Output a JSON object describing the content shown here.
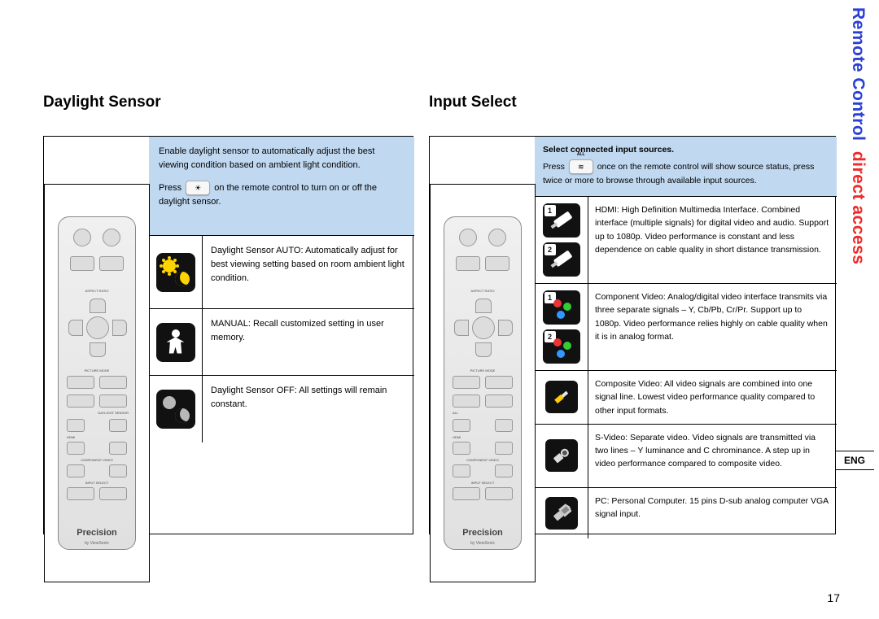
{
  "side_tab": {
    "line1": "Remote Control",
    "line2": "direct access"
  },
  "lang_badge": "ENG",
  "page_number": "17",
  "remote": {
    "brand": "Precision",
    "sub": "by ViewSonic",
    "labels": [
      "ASPECT RATIO",
      "PICTURE MODE",
      "DAYLIGHT SENSOR",
      "HDMI",
      "COMPONENT VIDEO",
      "INPUT SELECT",
      "ALL"
    ]
  },
  "daylight": {
    "title": "Daylight Sensor",
    "banner_line1": "Enable daylight sensor to automatically adjust the best viewing condition based on ambient light condition.",
    "banner_press": "Press",
    "banner_key": "☀",
    "banner_line2": "on the remote control to turn on or off the daylight sensor.",
    "rows": [
      {
        "icon": "sun-moon",
        "text": "Daylight Sensor AUTO: Automatically adjust for best viewing setting based on room ambient light condition."
      },
      {
        "icon": "person",
        "text": "MANUAL: Recall customized setting in user memory."
      },
      {
        "icon": "off",
        "text": "Daylight Sensor OFF: All settings will remain constant."
      }
    ]
  },
  "input": {
    "title": "Input Select",
    "banner_bold": "Select connected input sources.",
    "banner_press": "Press",
    "banner_key": "≋",
    "banner_key_label": "ALL",
    "banner_after": "once on the remote control will show source status, press twice or more to browse through available input sources.",
    "rows": [
      {
        "variant": "hdmi",
        "text": "HDMI: High Definition Multimedia Interface. Combined interface (multiple signals) for digital video and audio. Support up to 1080p. Video performance is constant and less dependence on cable quality in short distance transmission."
      },
      {
        "variant": "component",
        "text": "Component Video: Analog/digital video interface transmits via three separate signals – Y, Cb/Pb, Cr/Pr. Support up to 1080p. Video performance relies highly on cable quality when it is in analog format."
      },
      {
        "variant": "composite",
        "text": "Composite Video: All video signals are combined into one signal line. Lowest video performance quality compared to other input formats."
      },
      {
        "variant": "svideo",
        "text": "S-Video: Separate video. Video signals are transmitted via two lines – Y luminance and C chrominance. A step up in video performance compared to composite video."
      },
      {
        "variant": "pc",
        "text": "PC: Personal Computer. 15 pins D-sub analog computer VGA signal input."
      }
    ]
  }
}
